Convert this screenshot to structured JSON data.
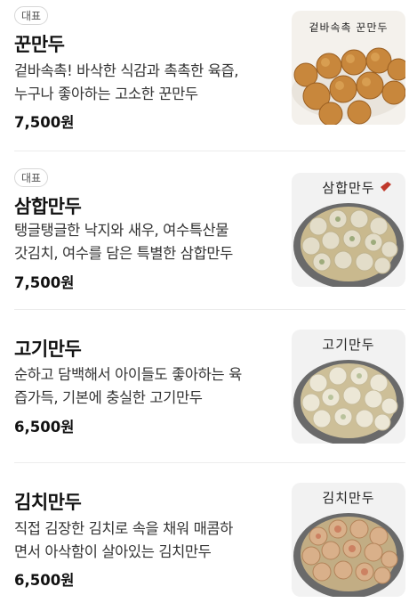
{
  "menu": [
    {
      "badge": "대표",
      "name": "꾼만두",
      "desc_line1": "겉바속촉! 바삭한 식감과 촉촉한 육즙,",
      "desc_line2": "누구나 좋아하는 고소한 꾼만두",
      "price": "7,500원",
      "image_label": "겉바속촉 꾼만두"
    },
    {
      "badge": "대표",
      "name": "삼합만두",
      "desc_line1": "탱글탱글한 낙지와 새우, 여수특산물",
      "desc_line2": "갓김치, 여수를 담은 특별한 삼합만두",
      "price": "7,500원",
      "image_label": "삼합만두"
    },
    {
      "name": "고기만두",
      "desc_line1": "순하고 담백해서 아이들도 좋아하는 육",
      "desc_line2": "즙가득, 기본에 충실한 고기만두",
      "price": "6,500원",
      "image_label": "고기만두"
    },
    {
      "name": "김치만두",
      "desc_line1": "직접 김장한 김치로 속을 채워 매콤하",
      "desc_line2": "면서 아삭함이 살아있는 김치만두",
      "price": "6,500원",
      "image_label": "김치만두"
    }
  ]
}
